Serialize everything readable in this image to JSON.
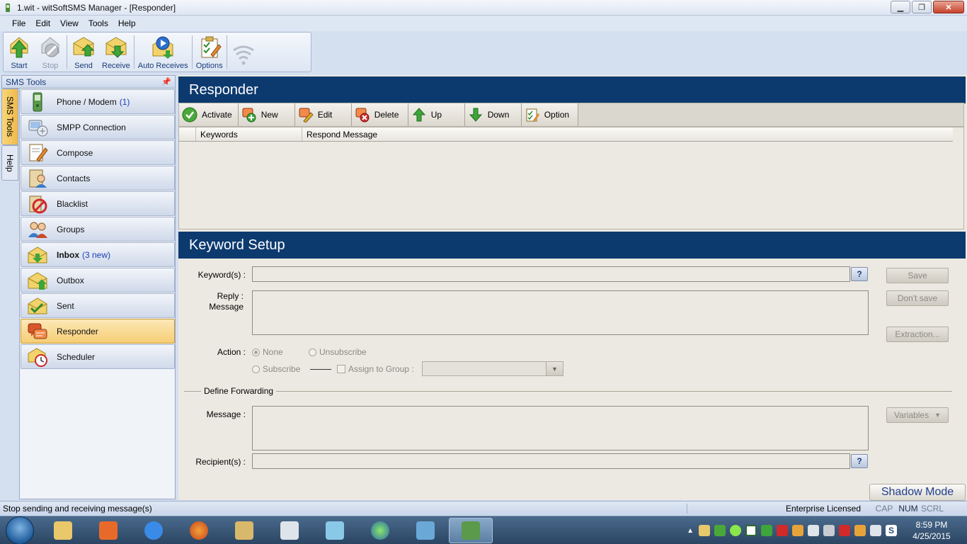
{
  "window": {
    "title": "1.wit - witSoftSMS Manager - [Responder]"
  },
  "menu": [
    "File",
    "Edit",
    "View",
    "Tools",
    "Help"
  ],
  "toolbar": {
    "start": "Start",
    "stop": "Stop",
    "send": "Send",
    "receive": "Receive",
    "auto_receives": "Auto Receives",
    "options": "Options"
  },
  "sidebar": {
    "header": "SMS Tools",
    "tabs": {
      "sms_tools": "SMS Tools",
      "help": "Help"
    },
    "items": [
      {
        "label": "Phone / Modem",
        "count": "(1)"
      },
      {
        "label": "SMPP Connection"
      },
      {
        "label": "Compose"
      },
      {
        "label": "Contacts"
      },
      {
        "label": "Blacklist"
      },
      {
        "label": "Groups"
      },
      {
        "label": "Inbox",
        "count": "(3 new)"
      },
      {
        "label": "Outbox"
      },
      {
        "label": "Sent"
      },
      {
        "label": "Responder"
      },
      {
        "label": "Scheduler"
      }
    ]
  },
  "responder": {
    "title": "Responder",
    "actions": {
      "activate": "Activate",
      "new": "New",
      "edit": "Edit",
      "delete": "Delete",
      "up": "Up",
      "down": "Down",
      "option": "Option"
    },
    "columns": {
      "keywords": "Keywords",
      "respond_message": "Respond Message"
    }
  },
  "keyword_setup": {
    "title": "Keyword Setup",
    "keywords_label": "Keyword(s) :",
    "reply_label_1": "Reply :",
    "reply_label_2": "Message",
    "action_label": "Action :",
    "none": "None",
    "unsubscribe": "Unsubscribe",
    "subscribe": "Subscribe",
    "assign_group": "Assign to Group :",
    "define_forwarding": "Define Forwarding",
    "message_label": "Message :",
    "recipients_label": "Recipient(s) :",
    "help_q": "?",
    "save": "Save",
    "dont_save": "Don't save",
    "extraction": "Extraction...",
    "variables": "Variables"
  },
  "shadow_mode": "Shadow Mode",
  "status": {
    "message": "Stop sending and receiving message(s)",
    "license": "Enterprise Licensed",
    "cap": "CAP",
    "num": "NUM",
    "scrl": "SCRL"
  },
  "clock": {
    "time": "8:59 PM",
    "date": "4/25/2015"
  }
}
